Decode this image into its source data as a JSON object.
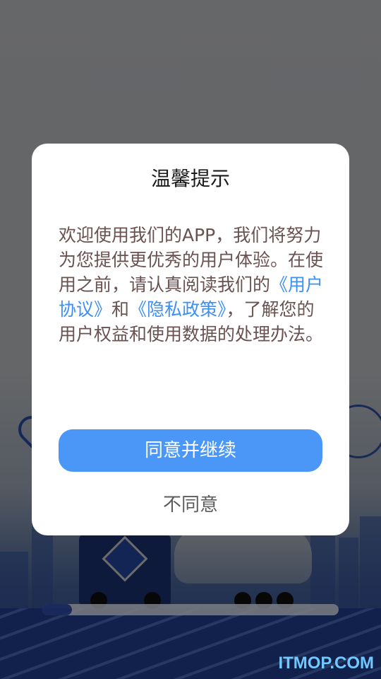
{
  "dialog": {
    "title": "温馨提示",
    "body_part1": "欢迎使用我们的APP，我们将努力为您提供更优秀的用户体验。在使用之前，请认真阅读我们的",
    "user_agreement_link": "《用户协议》",
    "body_and": "和",
    "privacy_policy_link": "《隐私政策》",
    "body_part2": "，了解您的用户权益和使用数据的处理办法。",
    "agree_button": "同意并继续",
    "disagree_button": "不同意"
  },
  "loading": {
    "progress_fraction": 0.1
  },
  "watermark": "ITMOP.COM",
  "colors": {
    "accent": "#4a97f7",
    "link": "#3e8ff4",
    "body_text": "#6a5252"
  },
  "icons": [
    "map-pin-icon",
    "hazmat-sign-icon"
  ]
}
